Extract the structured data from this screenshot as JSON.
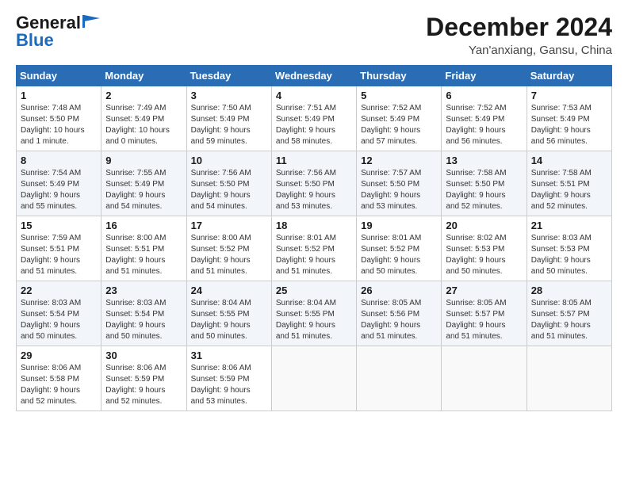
{
  "header": {
    "logo_line1": "General",
    "logo_line2": "Blue",
    "month": "December 2024",
    "location": "Yan'anxiang, Gansu, China"
  },
  "weekdays": [
    "Sunday",
    "Monday",
    "Tuesday",
    "Wednesday",
    "Thursday",
    "Friday",
    "Saturday"
  ],
  "weeks": [
    [
      {
        "day": "1",
        "info": "Sunrise: 7:48 AM\nSunset: 5:50 PM\nDaylight: 10 hours\nand 1 minute."
      },
      {
        "day": "2",
        "info": "Sunrise: 7:49 AM\nSunset: 5:49 PM\nDaylight: 10 hours\nand 0 minutes."
      },
      {
        "day": "3",
        "info": "Sunrise: 7:50 AM\nSunset: 5:49 PM\nDaylight: 9 hours\nand 59 minutes."
      },
      {
        "day": "4",
        "info": "Sunrise: 7:51 AM\nSunset: 5:49 PM\nDaylight: 9 hours\nand 58 minutes."
      },
      {
        "day": "5",
        "info": "Sunrise: 7:52 AM\nSunset: 5:49 PM\nDaylight: 9 hours\nand 57 minutes."
      },
      {
        "day": "6",
        "info": "Sunrise: 7:52 AM\nSunset: 5:49 PM\nDaylight: 9 hours\nand 56 minutes."
      },
      {
        "day": "7",
        "info": "Sunrise: 7:53 AM\nSunset: 5:49 PM\nDaylight: 9 hours\nand 56 minutes."
      }
    ],
    [
      {
        "day": "8",
        "info": "Sunrise: 7:54 AM\nSunset: 5:49 PM\nDaylight: 9 hours\nand 55 minutes."
      },
      {
        "day": "9",
        "info": "Sunrise: 7:55 AM\nSunset: 5:49 PM\nDaylight: 9 hours\nand 54 minutes."
      },
      {
        "day": "10",
        "info": "Sunrise: 7:56 AM\nSunset: 5:50 PM\nDaylight: 9 hours\nand 54 minutes."
      },
      {
        "day": "11",
        "info": "Sunrise: 7:56 AM\nSunset: 5:50 PM\nDaylight: 9 hours\nand 53 minutes."
      },
      {
        "day": "12",
        "info": "Sunrise: 7:57 AM\nSunset: 5:50 PM\nDaylight: 9 hours\nand 53 minutes."
      },
      {
        "day": "13",
        "info": "Sunrise: 7:58 AM\nSunset: 5:50 PM\nDaylight: 9 hours\nand 52 minutes."
      },
      {
        "day": "14",
        "info": "Sunrise: 7:58 AM\nSunset: 5:51 PM\nDaylight: 9 hours\nand 52 minutes."
      }
    ],
    [
      {
        "day": "15",
        "info": "Sunrise: 7:59 AM\nSunset: 5:51 PM\nDaylight: 9 hours\nand 51 minutes."
      },
      {
        "day": "16",
        "info": "Sunrise: 8:00 AM\nSunset: 5:51 PM\nDaylight: 9 hours\nand 51 minutes."
      },
      {
        "day": "17",
        "info": "Sunrise: 8:00 AM\nSunset: 5:52 PM\nDaylight: 9 hours\nand 51 minutes."
      },
      {
        "day": "18",
        "info": "Sunrise: 8:01 AM\nSunset: 5:52 PM\nDaylight: 9 hours\nand 51 minutes."
      },
      {
        "day": "19",
        "info": "Sunrise: 8:01 AM\nSunset: 5:52 PM\nDaylight: 9 hours\nand 50 minutes."
      },
      {
        "day": "20",
        "info": "Sunrise: 8:02 AM\nSunset: 5:53 PM\nDaylight: 9 hours\nand 50 minutes."
      },
      {
        "day": "21",
        "info": "Sunrise: 8:03 AM\nSunset: 5:53 PM\nDaylight: 9 hours\nand 50 minutes."
      }
    ],
    [
      {
        "day": "22",
        "info": "Sunrise: 8:03 AM\nSunset: 5:54 PM\nDaylight: 9 hours\nand 50 minutes."
      },
      {
        "day": "23",
        "info": "Sunrise: 8:03 AM\nSunset: 5:54 PM\nDaylight: 9 hours\nand 50 minutes."
      },
      {
        "day": "24",
        "info": "Sunrise: 8:04 AM\nSunset: 5:55 PM\nDaylight: 9 hours\nand 50 minutes."
      },
      {
        "day": "25",
        "info": "Sunrise: 8:04 AM\nSunset: 5:55 PM\nDaylight: 9 hours\nand 51 minutes."
      },
      {
        "day": "26",
        "info": "Sunrise: 8:05 AM\nSunset: 5:56 PM\nDaylight: 9 hours\nand 51 minutes."
      },
      {
        "day": "27",
        "info": "Sunrise: 8:05 AM\nSunset: 5:57 PM\nDaylight: 9 hours\nand 51 minutes."
      },
      {
        "day": "28",
        "info": "Sunrise: 8:05 AM\nSunset: 5:57 PM\nDaylight: 9 hours\nand 51 minutes."
      }
    ],
    [
      {
        "day": "29",
        "info": "Sunrise: 8:06 AM\nSunset: 5:58 PM\nDaylight: 9 hours\nand 52 minutes."
      },
      {
        "day": "30",
        "info": "Sunrise: 8:06 AM\nSunset: 5:59 PM\nDaylight: 9 hours\nand 52 minutes."
      },
      {
        "day": "31",
        "info": "Sunrise: 8:06 AM\nSunset: 5:59 PM\nDaylight: 9 hours\nand 53 minutes."
      },
      null,
      null,
      null,
      null
    ]
  ]
}
